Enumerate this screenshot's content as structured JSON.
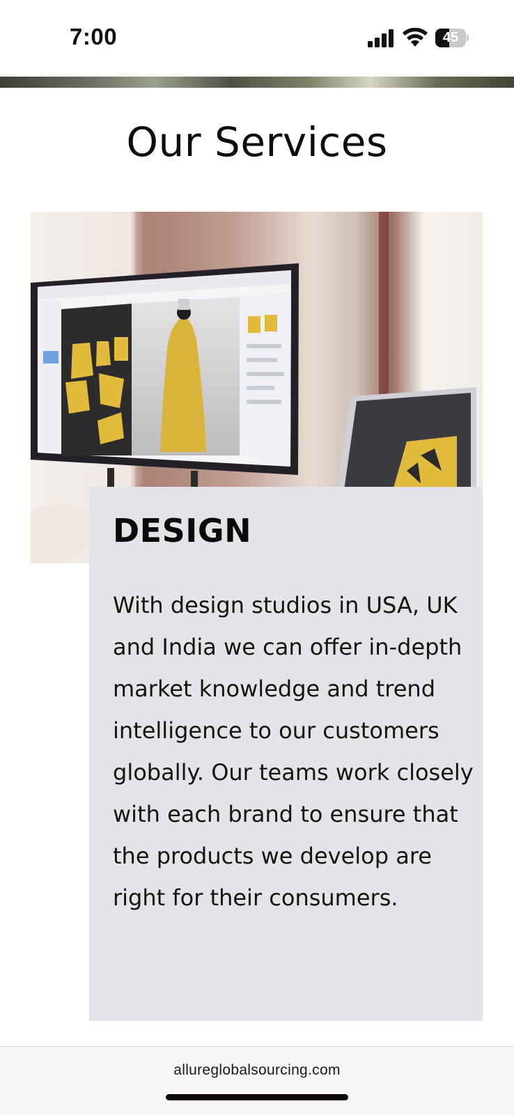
{
  "status_bar": {
    "time": "7:00",
    "battery_level": "45",
    "battery_fraction": 0.45,
    "icons": [
      "signal-icon",
      "wifi-icon",
      "battery-icon"
    ]
  },
  "services": {
    "title": "Our Services",
    "items": [
      {
        "heading": "DESIGN",
        "description": "With design studios in USA, UK and India we can offer in-depth market knowledge and trend intelligence to our customers globally. Our teams work closely with each brand to ensure that the products we develop are right for their consumers.",
        "image": "design-workstation-image"
      }
    ]
  },
  "browser": {
    "url": "allureglobalsourcing.com"
  },
  "colors": {
    "card_background": "#e5e3e8",
    "accent_yellow": "#e2bb3c",
    "text": "#111111"
  }
}
